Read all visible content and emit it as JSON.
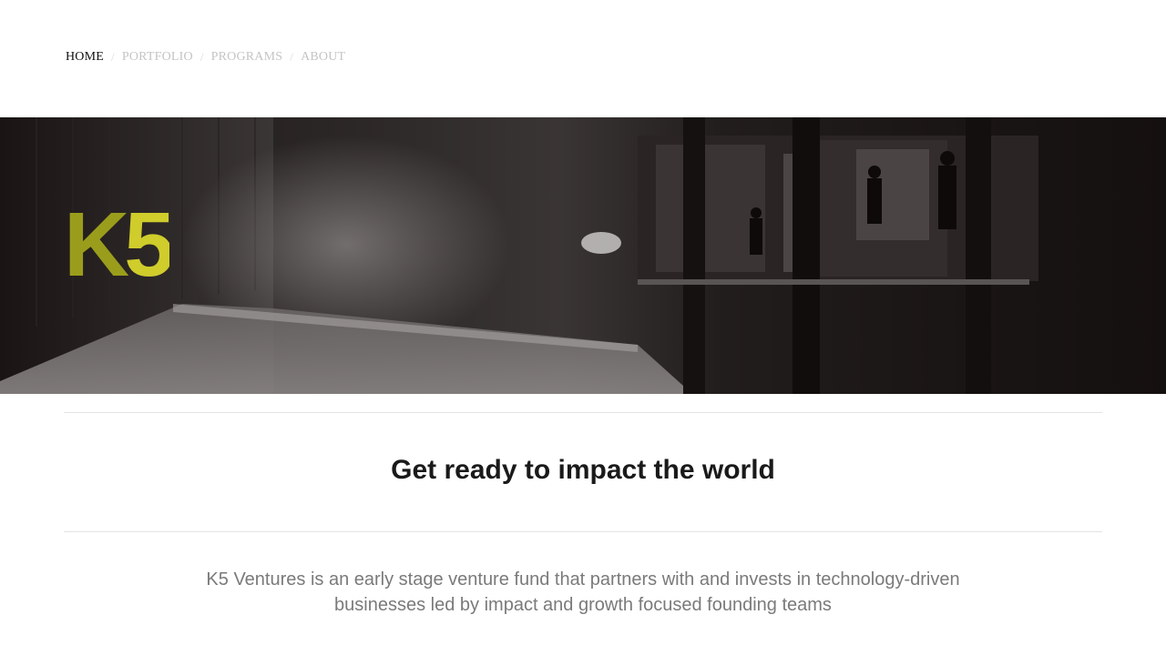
{
  "nav": {
    "items": [
      {
        "label": "HOME",
        "active": true
      },
      {
        "label": "PORTFOLIO",
        "active": false
      },
      {
        "label": "PROGRAMS",
        "active": false
      },
      {
        "label": "ABOUT",
        "active": false
      }
    ],
    "separator": "/"
  },
  "hero": {
    "logo_k": "K",
    "logo_5": "5",
    "logo_colors": {
      "k": "#9a9d1b",
      "five": "#cfcc2c"
    },
    "image_subject": "subway-platform-photo"
  },
  "main": {
    "headline": "Get ready to impact the world",
    "intro": "K5 Ventures is an early stage venture fund that partners with and invests in technology-driven businesses led by impact and growth focused founding teams"
  }
}
